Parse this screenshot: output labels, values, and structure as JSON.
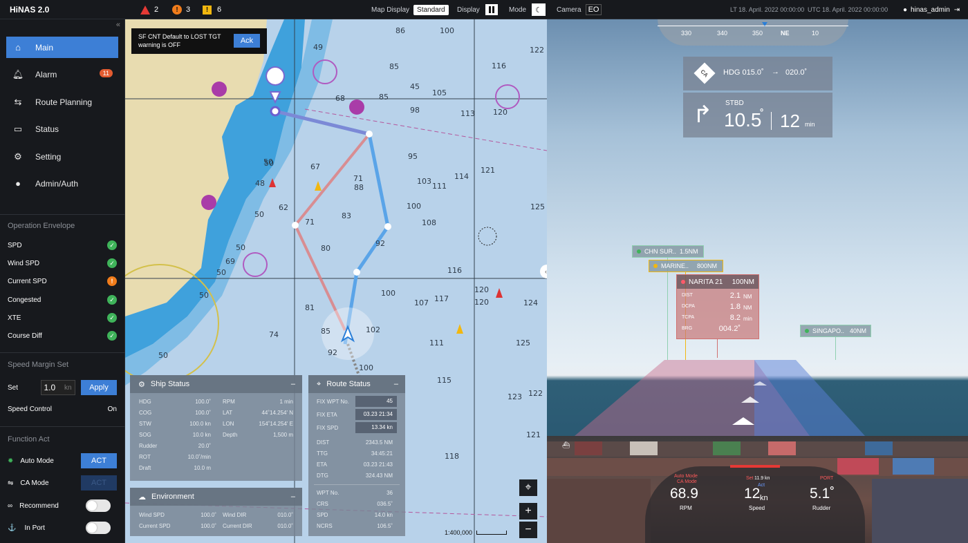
{
  "app": {
    "title": "HiNAS 2.0"
  },
  "alerts": {
    "red": "2",
    "orange": "3",
    "yellow": "6"
  },
  "topbar": {
    "map_display_label": "Map Display",
    "map_display_value": "Standard",
    "display_label": "Display",
    "mode_label": "Mode",
    "camera_label": "Camera",
    "camera_value": "EO",
    "lt": "LT 18. April. 2022 00:00:00",
    "utc": "UTC 18. April. 2022 00:00:00",
    "user": "hinas_admin"
  },
  "sidebar": {
    "collapse": "«",
    "nav": [
      {
        "label": "Main"
      },
      {
        "label": "Alarm",
        "badge": "11"
      },
      {
        "label": "Route Planning"
      },
      {
        "label": "Status"
      },
      {
        "label": "Setting"
      },
      {
        "label": "Admin/Auth"
      }
    ],
    "operation_envelope": {
      "title": "Operation Envelope",
      "items": [
        "SPD",
        "Wind SPD",
        "Current SPD",
        "Congested",
        "XTE",
        "Course Diff"
      ]
    },
    "speed_margin": {
      "title": "Speed Margin Set",
      "set_label": "Set",
      "value": "1.0",
      "unit": "kn",
      "apply": "Apply",
      "control_label": "Speed Control",
      "control_value": "On"
    },
    "function_act": {
      "title": "Function Act",
      "auto_mode": "Auto Mode",
      "ca_mode": "CA Mode",
      "recommend": "Recommend",
      "in_port": "In Port",
      "act": "ACT"
    }
  },
  "toast": {
    "line1": "SF CNT Default to LOST TGT",
    "line2": "warning is OFF",
    "ack": "Ack"
  },
  "map": {
    "scale": "1:400,000",
    "depths": [
      "86",
      "100",
      "122",
      "49",
      "85",
      "116",
      "45",
      "68",
      "85",
      "105",
      "120",
      "98",
      "113",
      "67",
      "95",
      "103",
      "114",
      "121",
      "71",
      "88",
      "100",
      "111",
      "125",
      "62",
      "71",
      "83",
      "108",
      "48",
      "92",
      "116",
      "80",
      "100",
      "107",
      "117",
      "120",
      "124",
      "81",
      "85",
      "102",
      "125",
      "92",
      "111",
      "100",
      "120",
      "115",
      "122",
      "123",
      "121",
      "118",
      "50",
      "50",
      "50",
      "50",
      "50",
      "50",
      "50",
      "69",
      "74"
    ]
  },
  "ship_status": {
    "title": "Ship Status",
    "min": "–",
    "left": [
      [
        "HDG",
        "100.0˚"
      ],
      [
        "COG",
        "100.0˚"
      ],
      [
        "STW",
        "100.0 kn"
      ],
      [
        "SOG",
        "10.0 kn"
      ],
      [
        "Rudder",
        "20.0˚"
      ],
      [
        "ROT",
        "10.0˚/min"
      ],
      [
        "Draft",
        "10.0 m"
      ]
    ],
    "right": [
      [
        "RPM",
        "1 min"
      ],
      [
        "LAT",
        "44˚14.254' N"
      ],
      [
        "LON",
        "154˚14.254' E"
      ],
      [
        "Depth",
        "1,500 m"
      ]
    ]
  },
  "environment": {
    "title": "Environment",
    "min": "–",
    "rows": [
      [
        "Wind SPD",
        "100.0˚",
        "Wind DIR",
        "010.0˚"
      ],
      [
        "Current SPD",
        "100.0˚",
        "Current DIR",
        "010.0˚"
      ]
    ]
  },
  "route_status": {
    "title": "Route Status",
    "min": "–",
    "fix": [
      [
        "FIX WPT No.",
        "45"
      ],
      [
        "FIX ETA",
        "03.23 21:34"
      ],
      [
        "FIX SPD",
        "13.34 kn"
      ]
    ],
    "rows": [
      [
        "DIST",
        "2343.5 NM"
      ],
      [
        "TTG",
        "34:45:21"
      ],
      [
        "ETA",
        "03.23 21:43"
      ],
      [
        "DTG",
        "324.43 NM"
      ]
    ],
    "wpt": [
      [
        "WPT No.",
        "36"
      ],
      [
        "CRS",
        "036.5˚"
      ],
      [
        "SPD",
        "14.0 kn"
      ],
      [
        "NCRS",
        "106.5˚"
      ]
    ]
  },
  "camera": {
    "compass": [
      "330",
      "340",
      "350",
      "NE",
      "10"
    ],
    "ca": {
      "badge": "CA",
      "hdg": "HDG 015.0˚",
      "arrow": "→",
      "target": "020.0˚",
      "dir": "STBD",
      "angle": "10.5",
      "deg": "˚",
      "time": "12",
      "unit": "min"
    },
    "targets": [
      {
        "name": "CHN SUR..",
        "dist": "1.5NM",
        "color": "#3fb35a"
      },
      {
        "name": "MARINE..",
        "dist": "800NM",
        "color": "#f2b70f"
      },
      {
        "name": "SINGAPO..",
        "dist": "40NM",
        "color": "#3fb35a"
      }
    ],
    "narita": {
      "name": "NARITA 21",
      "dist": "100NM",
      "rows": [
        [
          "DIST",
          "2.1",
          "NM"
        ],
        [
          "DCPA",
          "1.8",
          "NM"
        ],
        [
          "TCPA",
          "8.2",
          "min"
        ],
        [
          "BRG",
          "004.2˚",
          ""
        ]
      ]
    },
    "gauge": {
      "rpm_mode": "Auto Mode",
      "rpm_mode2": "CA Mode",
      "rpm": "68.9",
      "rpm_label": "RPM",
      "speed_set": "Set",
      "speed_set_val": "11.9 kn",
      "speed_act": "Act",
      "speed": "12",
      "speed_unit": "kn",
      "speed_label": "Speed",
      "rudder_side": "PORT",
      "rudder": "5.1˚",
      "rudder_label": "Rudder"
    }
  }
}
